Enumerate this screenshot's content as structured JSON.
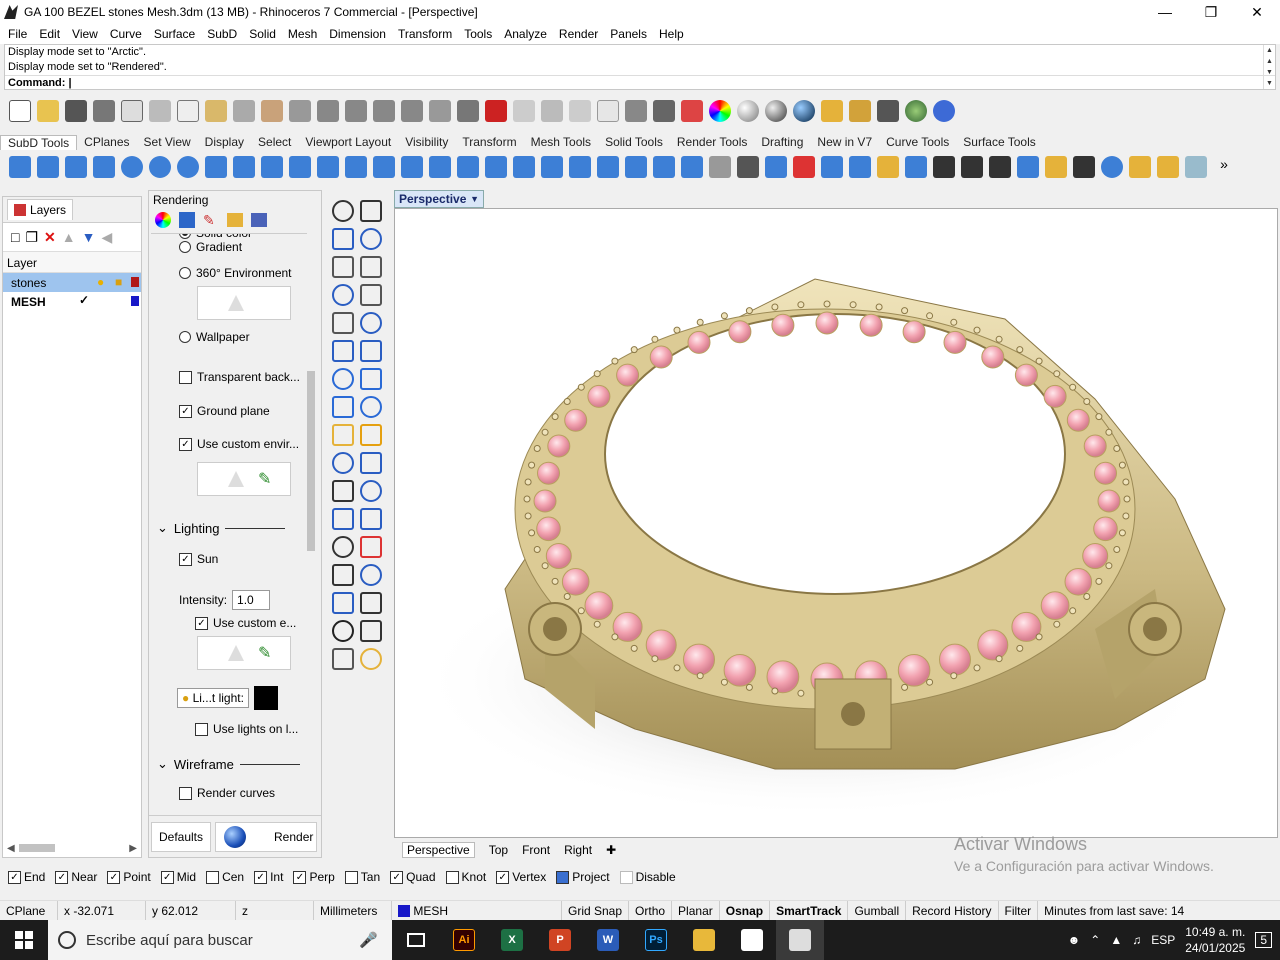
{
  "window": {
    "title": "GA 100 BEZEL stones Mesh.3dm (13 MB) - Rhinoceros 7 Commercial - [Perspective]"
  },
  "menu": [
    "File",
    "Edit",
    "View",
    "Curve",
    "Surface",
    "SubD",
    "Solid",
    "Mesh",
    "Dimension",
    "Transform",
    "Tools",
    "Analyze",
    "Render",
    "Panels",
    "Help"
  ],
  "command": {
    "line1": "Display mode set to \"Arctic\".",
    "line2": "Display mode set to \"Rendered\".",
    "prompt": "Command:"
  },
  "toolbar_tabs": [
    "SubD Tools",
    "CPlanes",
    "Set View",
    "Display",
    "Select",
    "Viewport Layout",
    "Visibility",
    "Transform",
    "Mesh Tools",
    "Solid Tools",
    "Render Tools",
    "Drafting",
    "New in V7",
    "Curve Tools",
    "Surface Tools"
  ],
  "layers": {
    "tab": "Layers",
    "column": "Layer",
    "rows": [
      {
        "name": "stones",
        "color": "#b01818"
      },
      {
        "name": "MESH",
        "color": "#1818c8"
      }
    ]
  },
  "rendering": {
    "title": "Rendering",
    "solid_color": "Solid color",
    "gradient": "Gradient",
    "environment": "360° Environment",
    "wallpaper": "Wallpaper",
    "transparent": "Transparent back...",
    "ground_plane": "Ground plane",
    "custom_env": "Use custom envir...",
    "lighting": "Lighting",
    "sun": "Sun",
    "intensity_label": "Intensity:",
    "intensity_value": "1.0",
    "custom_e": "Use custom e...",
    "light_label": "Li...t light:",
    "use_lights": "Use lights on l...",
    "wireframe": "Wireframe",
    "render_curves": "Render curves",
    "defaults": "Defaults",
    "render": "Render"
  },
  "viewport": {
    "label": "Perspective"
  },
  "viewport_tabs": [
    "Perspective",
    "Top",
    "Front",
    "Right"
  ],
  "watermark": {
    "line1": "Activar Windows",
    "line2": "Ve a Configuración para activar Windows."
  },
  "osnap": [
    "End",
    "Near",
    "Point",
    "Mid",
    "Cen",
    "Int",
    "Perp",
    "Tan",
    "Quad",
    "Knot",
    "Vertex",
    "Project",
    "Disable"
  ],
  "osnap_checked": [
    true,
    true,
    true,
    true,
    false,
    true,
    true,
    false,
    true,
    false,
    true,
    true,
    false
  ],
  "status": {
    "cplane": "CPlane",
    "x": "x -32.071",
    "y": "y 62.012",
    "z": "z",
    "units": "Millimeters",
    "layer": "MESH",
    "toggles": [
      "Grid Snap",
      "Ortho",
      "Planar",
      "Osnap",
      "SmartTrack",
      "Gumball",
      "Record History",
      "Filter"
    ],
    "bold_toggles": [
      "Osnap",
      "SmartTrack"
    ],
    "save": "Minutes from last save: 14"
  },
  "taskbar": {
    "search": "Escribe aquí para buscar",
    "apps": [
      "Ai",
      "X",
      "P",
      "W",
      "Ps"
    ],
    "lang": "ESP",
    "time": "10:49 a. m.",
    "date": "24/01/2025",
    "notif": "5"
  }
}
